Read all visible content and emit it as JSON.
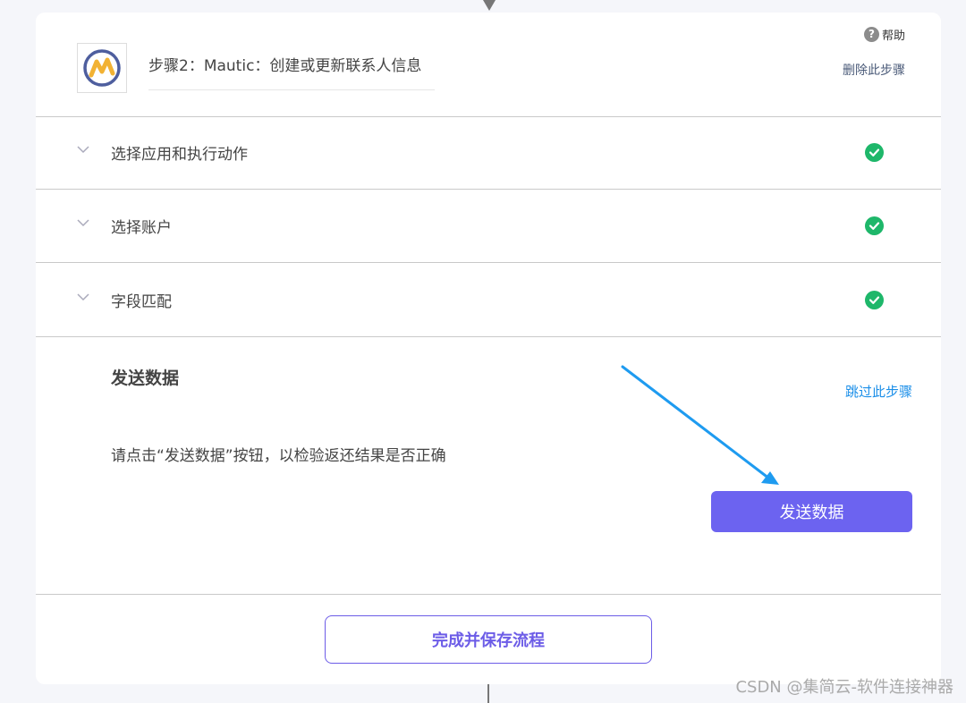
{
  "step": {
    "title": "步骤2：Mautic：创建或更新联系人信息",
    "help_label": "帮助",
    "delete_label": "删除此步骤",
    "help_icon_glyph": "?"
  },
  "sections": [
    {
      "label": "选择应用和执行动作",
      "status": "complete"
    },
    {
      "label": "选择账户",
      "status": "complete"
    },
    {
      "label": "字段匹配",
      "status": "complete"
    }
  ],
  "send_data": {
    "title": "发送数据",
    "skip_label": "跳过此步骤",
    "description": "请点击“发送数据”按钮，以检验返还结果是否正确",
    "button_label": "发送数据"
  },
  "footer": {
    "finish_label": "完成并保存流程"
  },
  "watermark": "CSDN @集简云-软件连接神器",
  "colors": {
    "accent": "#6c63f0",
    "success": "#1eb76a",
    "link": "#1a8ee8",
    "annotation_arrow": "#1e9bf0"
  },
  "icons": {
    "app_logo": "mautic-logo-icon",
    "help": "question-circle-icon",
    "collapse": "chevron-down-icon",
    "complete": "check-circle-icon"
  }
}
